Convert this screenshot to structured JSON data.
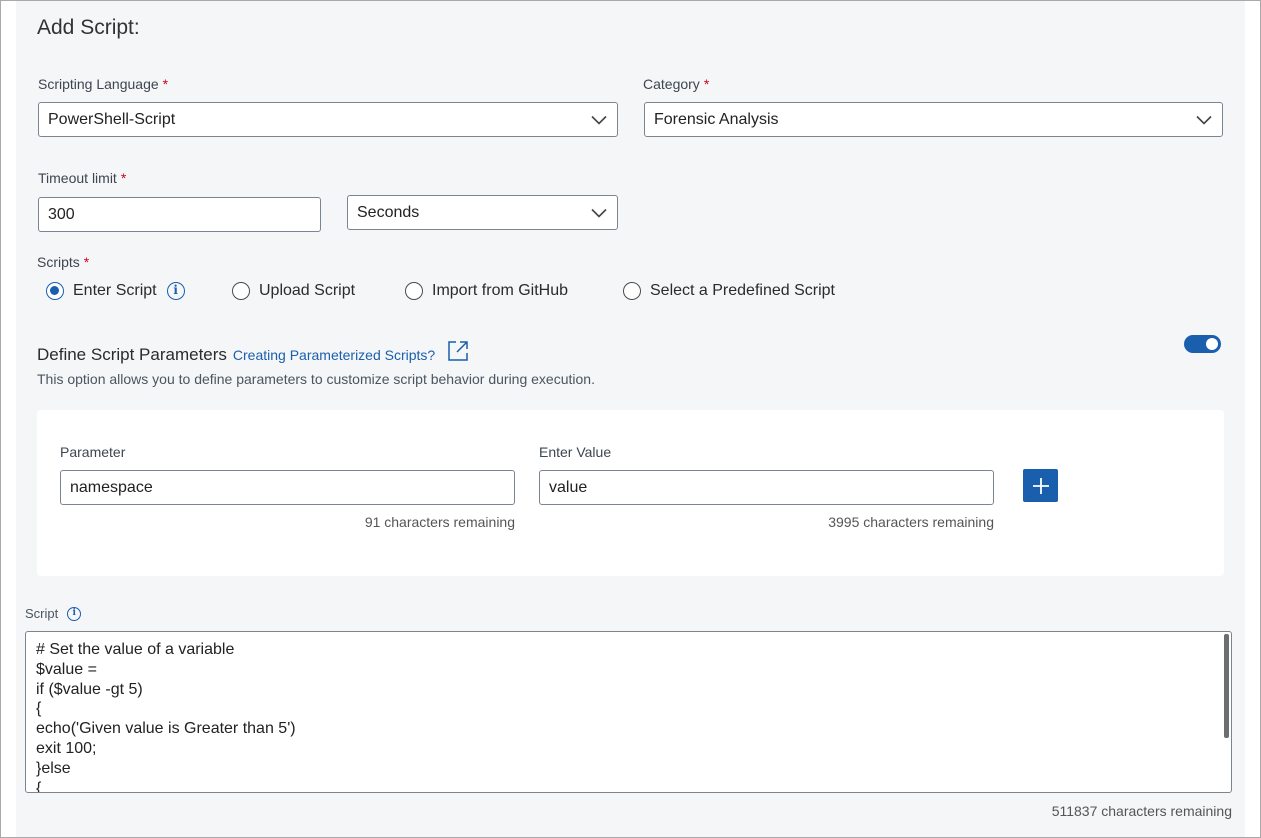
{
  "page": {
    "title": "Add Script:"
  },
  "language": {
    "label": "Scripting Language",
    "required_mark": "*",
    "value": "PowerShell-Script"
  },
  "category": {
    "label": "Category",
    "required_mark": "*",
    "value": "Forensic Analysis"
  },
  "timeout": {
    "label": "Timeout limit",
    "required_mark": "*",
    "value": "300",
    "unit": "Seconds"
  },
  "scripts": {
    "label": "Scripts",
    "required_mark": "*",
    "options": [
      {
        "label": "Enter Script",
        "checked": true
      },
      {
        "label": "Upload Script",
        "checked": false
      },
      {
        "label": "Import from GitHub",
        "checked": false
      },
      {
        "label": "Select a Predefined Script",
        "checked": false
      }
    ]
  },
  "define_params": {
    "title": "Define Script Parameters",
    "link": "Creating Parameterized Scripts?",
    "description": "This option allows you to define parameters to customize script behavior during execution.",
    "enabled": true
  },
  "parameter": {
    "label": "Parameter",
    "value": "namespace",
    "remaining": "91 characters remaining"
  },
  "enter_value": {
    "label": "Enter Value",
    "value": "value",
    "remaining": "3995 characters remaining"
  },
  "script": {
    "label": "Script",
    "lines": [
      "# Set the value of a variable",
      "$value =",
      "if ($value -gt 5)",
      "{",
      "echo('Given value is Greater than 5')",
      "exit 100;",
      "}else",
      "{"
    ],
    "remaining": "511837 characters remaining"
  },
  "icons": {
    "chevron": "chevron-down-icon",
    "info": "info-icon",
    "external": "external-link-icon",
    "plus": "plus-icon"
  },
  "colors": {
    "accent": "#1a5fad",
    "required": "#d0021b",
    "panel": "#f4f6f8"
  }
}
